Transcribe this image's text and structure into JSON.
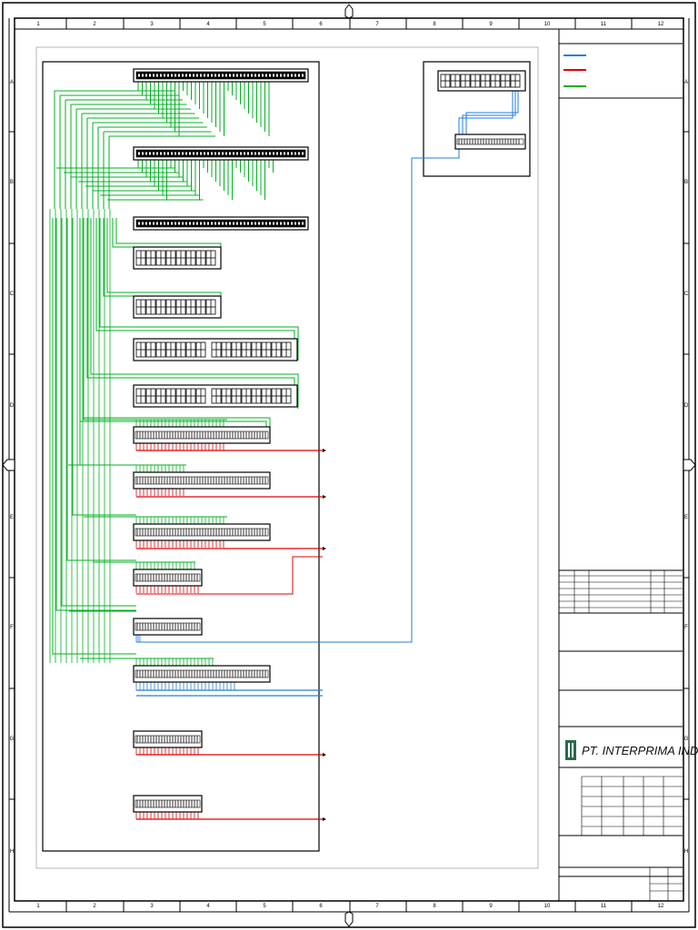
{
  "border": {
    "columns": [
      "1",
      "2",
      "3",
      "4",
      "5",
      "6",
      "7",
      "8",
      "9",
      "10",
      "11",
      "12"
    ],
    "rows": [
      "A",
      "B",
      "C",
      "D",
      "E",
      "F",
      "G",
      "H"
    ]
  },
  "title_block": {
    "company": "PT. INTERPRIMA INDOCOM"
  },
  "legend": {
    "colors": {
      "blue": "#1e7fe0",
      "red": "#e00000",
      "green": "#00b020"
    }
  }
}
